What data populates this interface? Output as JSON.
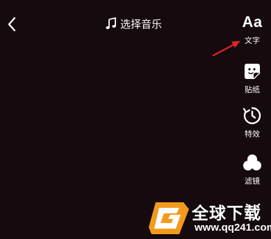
{
  "header": {
    "back_icon": "chevron-left-icon",
    "music_icon": "music-note-icon",
    "music_label": "选择音乐"
  },
  "toolbar": {
    "text": {
      "glyph": "Aa",
      "label": "文字",
      "icon": "text-icon"
    },
    "sticker": {
      "label": "贴纸",
      "icon": "sticker-icon"
    },
    "effects": {
      "label": "特效",
      "icon": "timer-effects-icon"
    },
    "filter": {
      "label": "滤镜",
      "icon": "filter-circles-icon"
    }
  },
  "annotation": {
    "icon": "red-arrow-icon",
    "color": "#e0242b"
  },
  "collapse": {
    "icon": "chevron-down-icon"
  },
  "watermark": {
    "title": "全球下载",
    "url": "www.qq241.com",
    "logo_color": "#f39a1d"
  },
  "colors": {
    "background": "#150a0d",
    "foreground": "#ffffff"
  }
}
